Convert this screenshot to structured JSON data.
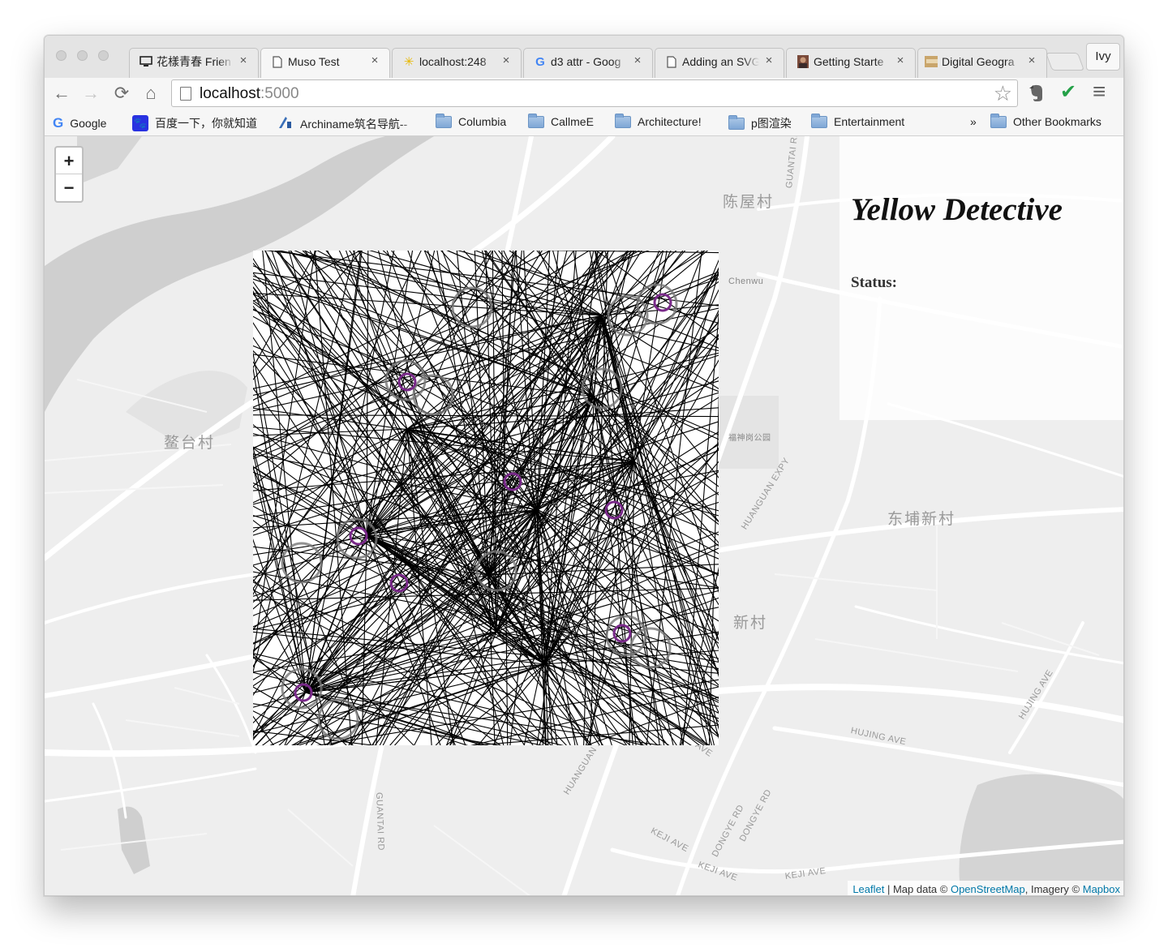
{
  "browser": {
    "tabs": [
      {
        "title": "花樣青春 Frien",
        "icon": "monitor-icon",
        "active": false
      },
      {
        "title": "Muso Test",
        "icon": "page-icon",
        "active": true
      },
      {
        "title": "localhost:248",
        "icon": "spark-icon",
        "active": false
      },
      {
        "title": "d3 attr - Goog",
        "icon": "google-g-icon",
        "active": false
      },
      {
        "title": "Adding an SVG",
        "icon": "page-icon",
        "active": false
      },
      {
        "title": "Getting Starte",
        "icon": "avatar-icon",
        "active": false
      },
      {
        "title": "Digital Geogra",
        "icon": "thumbnail-icon",
        "active": false
      }
    ],
    "profile_name": "Ivy",
    "url_host": "localhost",
    "url_port": ":5000",
    "bookmarks": [
      {
        "label": "Google",
        "icon": "google-g-icon"
      },
      {
        "label": "百度一下，你就知道",
        "icon": "baidu-paw-icon"
      },
      {
        "label": "Archiname筑名导航--",
        "icon": "archiname-icon"
      },
      {
        "label": "Columbia",
        "icon": "folder-icon"
      },
      {
        "label": "CallmeE",
        "icon": "folder-icon"
      },
      {
        "label": "Architecture!",
        "icon": "folder-icon"
      },
      {
        "label": "p图渲染",
        "icon": "folder-icon"
      },
      {
        "label": "Entertainment",
        "icon": "folder-icon"
      }
    ],
    "bookmarks_overflow": "»",
    "other_bookmarks": "Other Bookmarks",
    "nav_glyphs": {
      "back": "←",
      "forward": "→",
      "reload": "⟳",
      "home": "⌂",
      "star": "☆",
      "menu": "≡",
      "check": "✔"
    }
  },
  "map": {
    "zoom_in": "+",
    "zoom_out": "−",
    "place_labels": [
      "陈屋村",
      "鳌台村",
      "东埔新村",
      "新村"
    ],
    "road_labels": [
      "GUANTAI RD",
      "HUANGUAN EXPY",
      "HUJING AVE",
      "HUJING AVE",
      "HUJING AVE",
      "GUANTAI RD",
      "KEJI AVE",
      "KEJI AVE",
      "KEJI AVE",
      "DONGYE RD",
      "DONGYE RD",
      "HUANGUAN EXPY"
    ],
    "poi_labels": [
      "Chenwu",
      "福神岗公园"
    ],
    "attribution": {
      "leaflet": "Leaflet",
      "sep1": " | Map data © ",
      "osm": "OpenStreetMap",
      "sep2": ", Imagery © ",
      "mapbox": "Mapbox"
    }
  },
  "panel": {
    "title": "Yellow Detective",
    "status_label": "Status:"
  }
}
